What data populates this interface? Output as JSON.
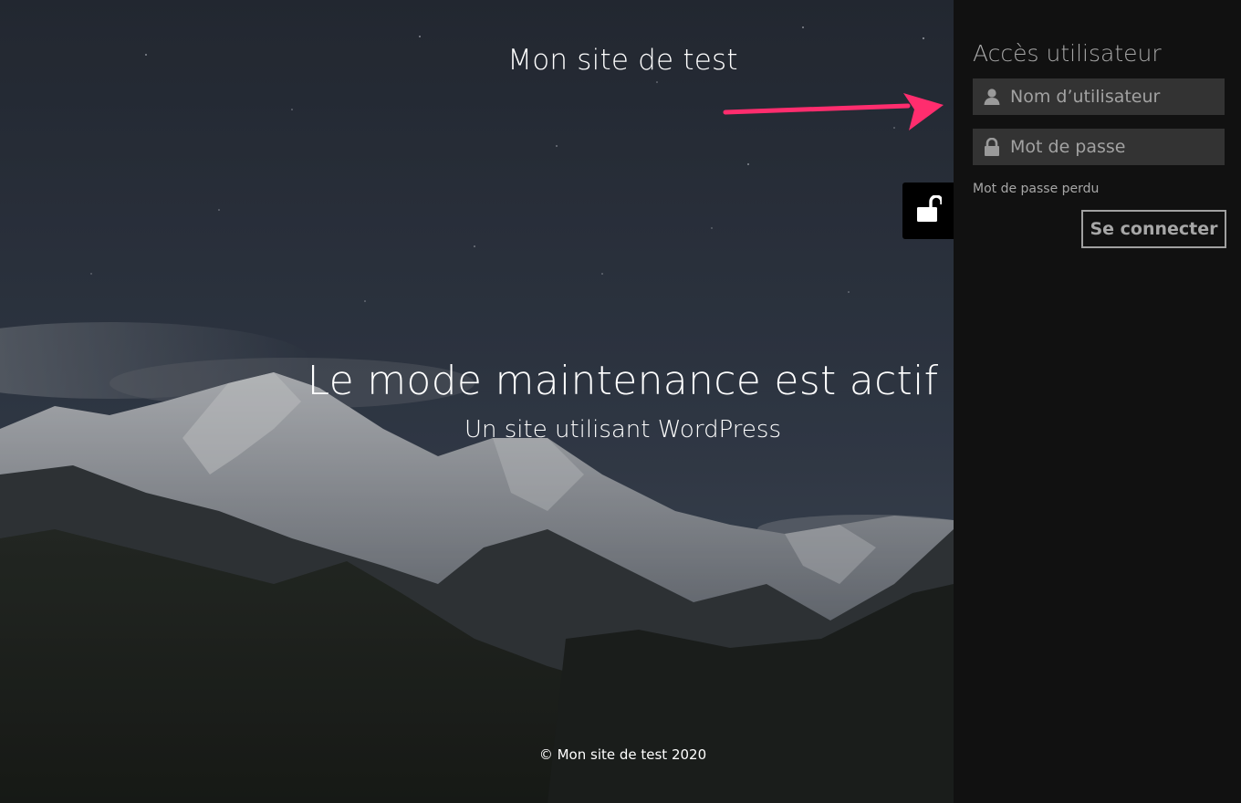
{
  "site": {
    "title": "Mon site de test",
    "heading": "Le mode maintenance est actif",
    "subheading": "Un site utilisant WordPress",
    "footer": "© Mon site de test 2020"
  },
  "login": {
    "title": "Accès utilisateur",
    "username_placeholder": "Nom d’utilisateur",
    "username_value": "",
    "password_placeholder": "Mot de passe",
    "password_value": "",
    "lost_password_label": "Mot de passe perdu",
    "submit_label": "Se connecter"
  },
  "icons": {
    "lock_toggle": "unlocked-padlock-icon",
    "username": "user-icon",
    "password": "padlock-icon",
    "annotation": "arrow-icon"
  },
  "colors": {
    "panel_background": "#111111",
    "field_background": "#333333",
    "panel_text": "#a7a7a7",
    "annotation_arrow": "#ff2d6e",
    "heading_text": "#ffffff"
  }
}
